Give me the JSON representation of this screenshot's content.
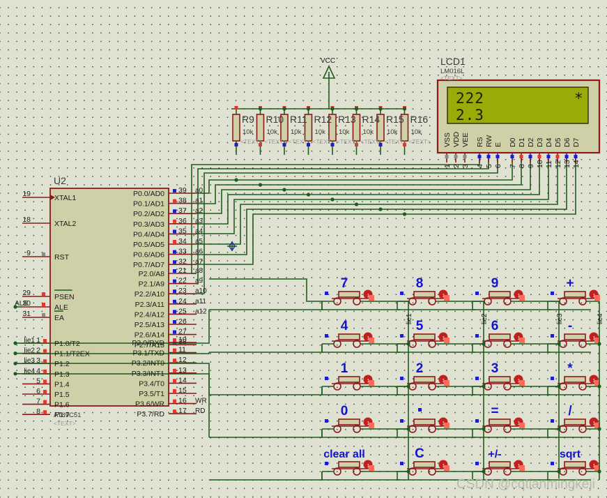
{
  "app": {
    "kind": "proteus-schematic",
    "background": "#dfe1d1",
    "wire_color": "#1d5c1d",
    "body_color": "#8b1a1a"
  },
  "power": {
    "vcc_label": "VCC"
  },
  "mcu": {
    "reference": "U2",
    "part": "AT89C51",
    "text_tag": "<TEXT>",
    "left_pins": [
      {
        "num": "19",
        "name": "XTAL1",
        "sq": "none"
      },
      {
        "num": "18",
        "name": "XTAL2",
        "sq": "none"
      },
      {
        "num": "9",
        "name": "RST",
        "sq": "gray"
      },
      {
        "num": "29",
        "name": "PSEN",
        "sq": "red",
        "overline": true
      },
      {
        "num": "30",
        "name": "ALE",
        "sq": "red",
        "net": "ALE"
      },
      {
        "num": "31",
        "name": "EA",
        "sq": "gray",
        "overline": true
      }
    ],
    "p1_pins": [
      {
        "num": "1",
        "name": "P1.0/T2",
        "sq": "red",
        "net": "lie1"
      },
      {
        "num": "2",
        "name": "P1.1/T2EX",
        "sq": "red",
        "net": "lie2"
      },
      {
        "num": "3",
        "name": "P1.2",
        "sq": "red",
        "net": "lie3"
      },
      {
        "num": "4",
        "name": "P1.3",
        "sq": "red",
        "net": "lie4"
      },
      {
        "num": "5",
        "name": "P1.4",
        "sq": "red",
        "net": ""
      },
      {
        "num": "6",
        "name": "P1.5",
        "sq": "red",
        "net": ""
      },
      {
        "num": "7",
        "name": "P1.6",
        "sq": "red",
        "net": ""
      },
      {
        "num": "8",
        "name": "P1.7",
        "sq": "red",
        "net": ""
      }
    ],
    "p0_pins": [
      {
        "num": "39",
        "name": "P0.0/AD0",
        "sq": "blue",
        "net": "a0"
      },
      {
        "num": "38",
        "name": "P0.1/AD1",
        "sq": "red",
        "net": "a1"
      },
      {
        "num": "37",
        "name": "P0.2/AD2",
        "sq": "blue",
        "net": "a2"
      },
      {
        "num": "36",
        "name": "P0.3/AD3",
        "sq": "red",
        "net": "a3"
      },
      {
        "num": "35",
        "name": "P0.4/AD4",
        "sq": "blue",
        "net": "a4"
      },
      {
        "num": "34",
        "name": "P0.5/AD5",
        "sq": "red",
        "net": "a5"
      },
      {
        "num": "33",
        "name": "P0.6/AD6",
        "sq": "blue",
        "net": "a6"
      },
      {
        "num": "32",
        "name": "P0.7/AD7",
        "sq": "blue",
        "net": "a7"
      }
    ],
    "p2_pins": [
      {
        "num": "21",
        "name": "P2.0/A8",
        "sq": "blue",
        "net": "a8"
      },
      {
        "num": "22",
        "name": "P2.1/A9",
        "sq": "blue",
        "net": "a9"
      },
      {
        "num": "23",
        "name": "P2.2/A10",
        "sq": "blue",
        "net": "a10"
      },
      {
        "num": "24",
        "name": "P2.3/A11",
        "sq": "blue",
        "net": "a11"
      },
      {
        "num": "25",
        "name": "P2.4/A12",
        "sq": "blue",
        "net": "a12"
      },
      {
        "num": "26",
        "name": "P2.5/A13",
        "sq": "blue",
        "net": ""
      },
      {
        "num": "27",
        "name": "P2.6/A14",
        "sq": "blue",
        "net": ""
      },
      {
        "num": "28",
        "name": "P2.7/A15",
        "sq": "blue",
        "net": ""
      }
    ],
    "p3_pins": [
      {
        "num": "10",
        "name": "P3.0/RXD",
        "sq": "red",
        "net": ""
      },
      {
        "num": "11",
        "name": "P3.1/TXD",
        "sq": "red",
        "net": ""
      },
      {
        "num": "12",
        "name": "P3.2/INT0",
        "sq": "red",
        "net": ""
      },
      {
        "num": "13",
        "name": "P3.3/INT1",
        "sq": "red",
        "net": ""
      },
      {
        "num": "14",
        "name": "P3.4/T0",
        "sq": "red",
        "net": ""
      },
      {
        "num": "15",
        "name": "P3.5/T1",
        "sq": "red",
        "net": ""
      },
      {
        "num": "16",
        "name": "P3.6/WR",
        "sq": "red",
        "net": "WR"
      },
      {
        "num": "17",
        "name": "P3.7/RD",
        "sq": "red",
        "net": "RD"
      }
    ]
  },
  "resistors": [
    {
      "ref": "R9",
      "value": "10k",
      "text_tag": "<TEXT>"
    },
    {
      "ref": "R10",
      "value": "10k",
      "text_tag": "<TEXT>"
    },
    {
      "ref": "R11",
      "value": "10k",
      "text_tag": "<TEXT>"
    },
    {
      "ref": "R12",
      "value": "10k",
      "text_tag": "<TEXT>"
    },
    {
      "ref": "R13",
      "value": "10k",
      "text_tag": "<TEXT>"
    },
    {
      "ref": "R14",
      "value": "10k",
      "text_tag": "<TEXT>"
    },
    {
      "ref": "R15",
      "value": "10k",
      "text_tag": "<TEXT>"
    },
    {
      "ref": "R16",
      "value": "10k",
      "text_tag": "<TEXT>"
    }
  ],
  "lcd": {
    "reference": "LCD1",
    "part": "LM016L",
    "text_tag": "<TEXT>",
    "screen_color": "#9aab09",
    "line1": "222",
    "line1_right": "*",
    "line2": "2.3",
    "pins": [
      {
        "num": "1",
        "name": "VSS",
        "sq": "gray"
      },
      {
        "num": "2",
        "name": "VDD",
        "sq": "gray"
      },
      {
        "num": "3",
        "name": "VEE",
        "sq": "gray"
      },
      {
        "num": "4",
        "name": "RS",
        "sq": "blue"
      },
      {
        "num": "5",
        "name": "RW",
        "sq": "blue"
      },
      {
        "num": "6",
        "name": "E",
        "sq": "blue"
      },
      {
        "num": "7",
        "name": "D0",
        "sq": "blue"
      },
      {
        "num": "8",
        "name": "D1",
        "sq": "red"
      },
      {
        "num": "9",
        "name": "D2",
        "sq": "blue"
      },
      {
        "num": "10",
        "name": "D3",
        "sq": "red"
      },
      {
        "num": "11",
        "name": "D4",
        "sq": "blue"
      },
      {
        "num": "12",
        "name": "D5",
        "sq": "red"
      },
      {
        "num": "13",
        "name": "D6",
        "sq": "blue"
      },
      {
        "num": "14",
        "name": "D7",
        "sq": "blue"
      }
    ]
  },
  "keypad": {
    "column_nets": [
      "lie1",
      "lie2",
      "lie3",
      "lie4"
    ],
    "rows": [
      [
        "7",
        "8",
        "9",
        "+"
      ],
      [
        "4",
        "5",
        "6",
        "-"
      ],
      [
        "1",
        "2",
        "3",
        "*"
      ],
      [
        "0",
        "",
        "=",
        "/"
      ],
      [
        "clear all",
        "C",
        "+/-",
        "sqrt"
      ]
    ]
  },
  "watermark": {
    "text": "CSDN @cqtianmingkeji"
  }
}
